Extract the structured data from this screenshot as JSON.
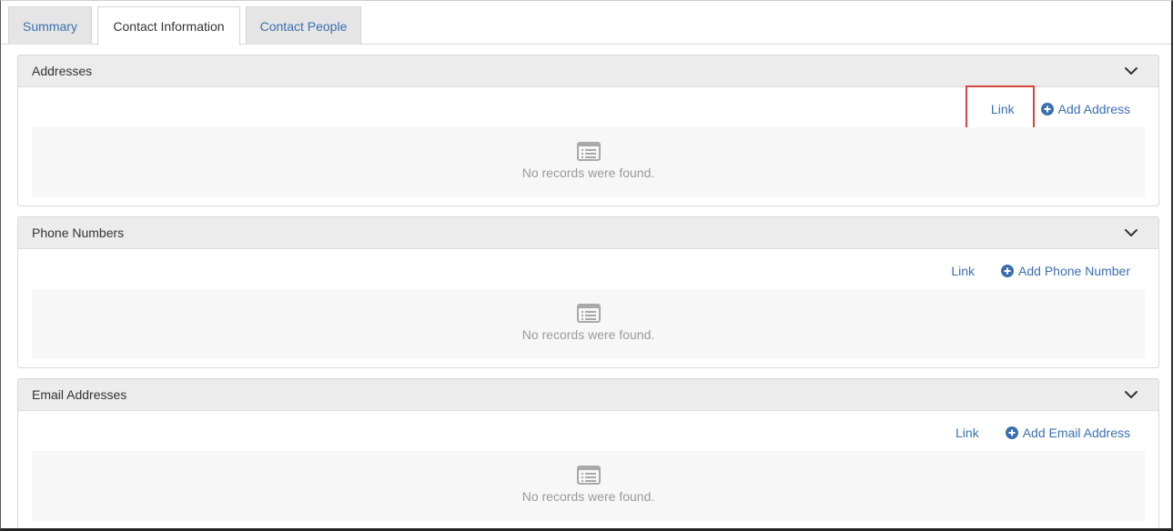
{
  "tabs": [
    {
      "label": "Summary",
      "active": false
    },
    {
      "label": "Contact Information",
      "active": true
    },
    {
      "label": "Contact People",
      "active": false
    }
  ],
  "sections": [
    {
      "title": "Addresses",
      "link_label": "Link",
      "add_label": "Add Address",
      "empty_text": "No records were found."
    },
    {
      "title": "Phone Numbers",
      "link_label": "Link",
      "add_label": "Add Phone Number",
      "empty_text": "No records were found."
    },
    {
      "title": "Email Addresses",
      "link_label": "Link",
      "add_label": "Add Email Address",
      "empty_text": "No records were found."
    }
  ],
  "icons": {
    "chevron": "chevron-down-icon",
    "add": "plus-circle-icon",
    "empty": "list-icon"
  },
  "colors": {
    "link": "#3a6fb0",
    "highlight": "#d9443a",
    "header_bg": "#ececec",
    "empty_bg": "#f7f7f7",
    "empty_text": "#9a9a9a"
  }
}
